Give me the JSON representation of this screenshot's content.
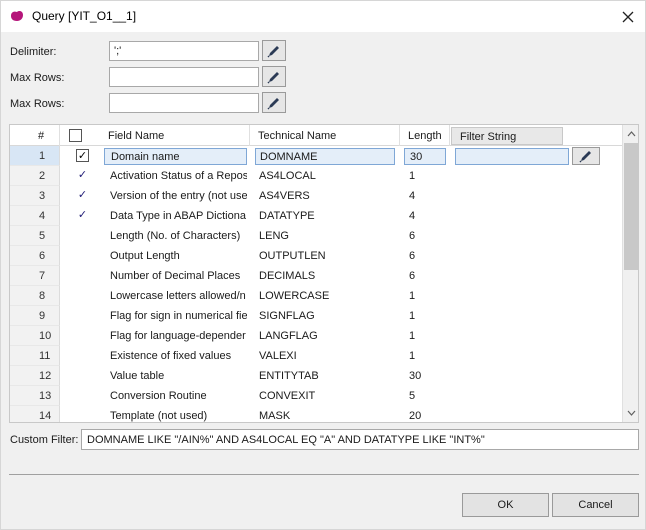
{
  "window": {
    "title": "Query [YIT_O1__1]"
  },
  "form": {
    "delimiter_label": "Delimiter:",
    "delimiter_value": "';'",
    "maxrows_label": "Max Rows:",
    "maxrows_value": "",
    "maxrows2_label": "Max Rows:",
    "maxrows2_value": ""
  },
  "grid": {
    "columns": {
      "num": "#",
      "field": "Field Name",
      "tech": "Technical Name",
      "len": "Length",
      "filter": "Filter String"
    },
    "rows": [
      {
        "num": "1",
        "check": "✓",
        "field": "Domain name",
        "tech": "DOMNAME",
        "len": "30"
      },
      {
        "num": "2",
        "check": "✓",
        "field": "Activation Status of a Repos",
        "tech": "AS4LOCAL",
        "len": "1"
      },
      {
        "num": "3",
        "check": "✓",
        "field": "Version of the entry (not use",
        "tech": "AS4VERS",
        "len": "4"
      },
      {
        "num": "4",
        "check": "✓",
        "field": "Data Type in ABAP Dictiona",
        "tech": "DATATYPE",
        "len": "4"
      },
      {
        "num": "5",
        "check": "",
        "field": "Length (No. of Characters)",
        "tech": "LENG",
        "len": "6"
      },
      {
        "num": "6",
        "check": "",
        "field": "Output Length",
        "tech": "OUTPUTLEN",
        "len": "6"
      },
      {
        "num": "7",
        "check": "",
        "field": "Number of Decimal Places",
        "tech": "DECIMALS",
        "len": "6"
      },
      {
        "num": "8",
        "check": "",
        "field": "Lowercase letters allowed/n",
        "tech": "LOWERCASE",
        "len": "1"
      },
      {
        "num": "9",
        "check": "",
        "field": "Flag for sign in numerical fie",
        "tech": "SIGNFLAG",
        "len": "1"
      },
      {
        "num": "10",
        "check": "",
        "field": "Flag for language-depender",
        "tech": "LANGFLAG",
        "len": "1"
      },
      {
        "num": "11",
        "check": "",
        "field": "Existence of fixed values",
        "tech": "VALEXI",
        "len": "1"
      },
      {
        "num": "12",
        "check": "",
        "field": "Value table",
        "tech": "ENTITYTAB",
        "len": "30"
      },
      {
        "num": "13",
        "check": "",
        "field": "Conversion Routine",
        "tech": "CONVEXIT",
        "len": "5"
      },
      {
        "num": "14",
        "check": "",
        "field": "Template (not used)",
        "tech": "MASK",
        "len": "20"
      }
    ]
  },
  "custom_filter": {
    "label": "Custom Filter:",
    "value": "DOMNAME LIKE \"/AIN%\" AND AS4LOCAL EQ \"A\" AND DATATYPE LIKE \"INT%\""
  },
  "buttons": {
    "ok": "OK",
    "cancel": "Cancel"
  },
  "icons": {
    "app": "app-logo-icon",
    "close": "close-icon",
    "edit": "pencil-icon",
    "scroll_up": "chevron-up-icon",
    "scroll_down": "chevron-down-icon"
  },
  "colors": {
    "app_icon": "#b5157a",
    "check": "#1f1a75",
    "selection": "#7fa7d6"
  }
}
